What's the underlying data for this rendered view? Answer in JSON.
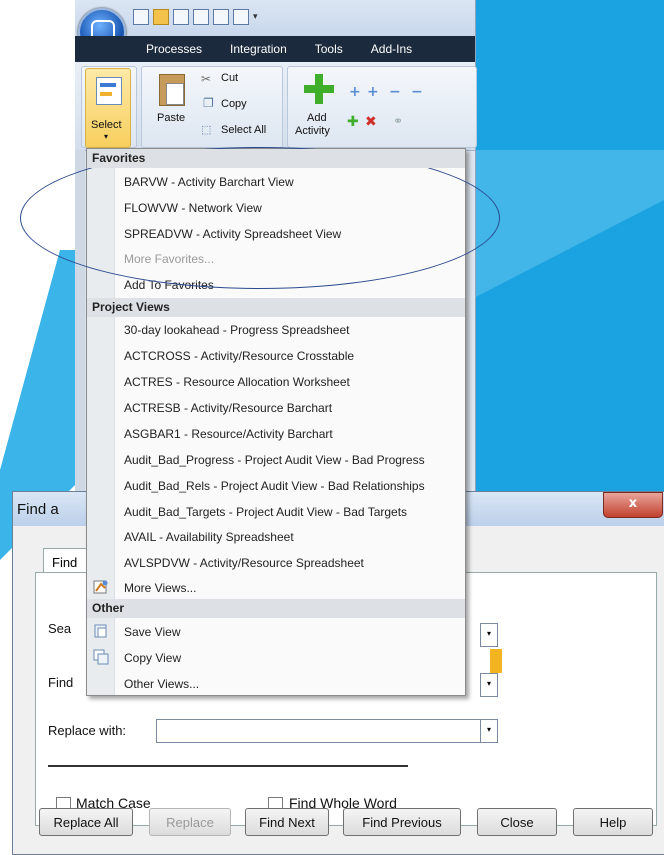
{
  "colors": {
    "slide_blue": "#1aa3e0",
    "slide_blue_light": "#5ec1ee",
    "accent": "#2b4a8e"
  },
  "ribbon": {
    "menus": [
      "Processes",
      "Integration",
      "Tools",
      "Add-Ins"
    ],
    "select_label": "Select",
    "paste_label": "Paste",
    "cut_label": "Cut",
    "copy_label": "Copy",
    "select_all_label": "Select All",
    "add_activity_label1": "Add",
    "add_activity_label2": "Activity"
  },
  "menu": {
    "favorites_header": "Favorites",
    "favorites": [
      "BARVW - Activity Barchart View",
      "FLOWVW - Network View",
      "SPREADVW - Activity Spreadsheet View"
    ],
    "more_favorites": "More Favorites...",
    "add_to_favorites": "Add To Favorites",
    "project_views_header": "Project Views",
    "project_views": [
      "30-day lookahead - Progress Spreadsheet",
      "ACTCROSS - Activity/Resource Crosstable",
      "ACTRES - Resource Allocation Worksheet",
      "ACTRESB - Activity/Resource Barchart",
      "ASGBAR1 - Resource/Activity Barchart",
      "Audit_Bad_Progress - Project Audit View - Bad Progress",
      "Audit_Bad_Rels - Project Audit View - Bad Relationships",
      "Audit_Bad_Targets - Project Audit View - Bad Targets",
      "AVAIL - Availability Spreadsheet",
      "AVLSPDVW - Activity/Resource Spreadsheet"
    ],
    "more_views": "More Views...",
    "other_header": "Other",
    "save_view": "Save View",
    "copy_view": "Copy View",
    "other_views": "Other Views..."
  },
  "dialog": {
    "title": "Find a",
    "close": "x",
    "tab": "Find",
    "search_label": "Sea",
    "find_label": "Find",
    "replace_label": "Replace with:",
    "match_case": "Match Case",
    "find_whole_word": "Find Whole Word",
    "buttons": {
      "replace_all": "Replace All",
      "replace": "Replace",
      "find_next": "Find Next",
      "find_previous": "Find Previous",
      "close": "Close",
      "help": "Help"
    }
  }
}
